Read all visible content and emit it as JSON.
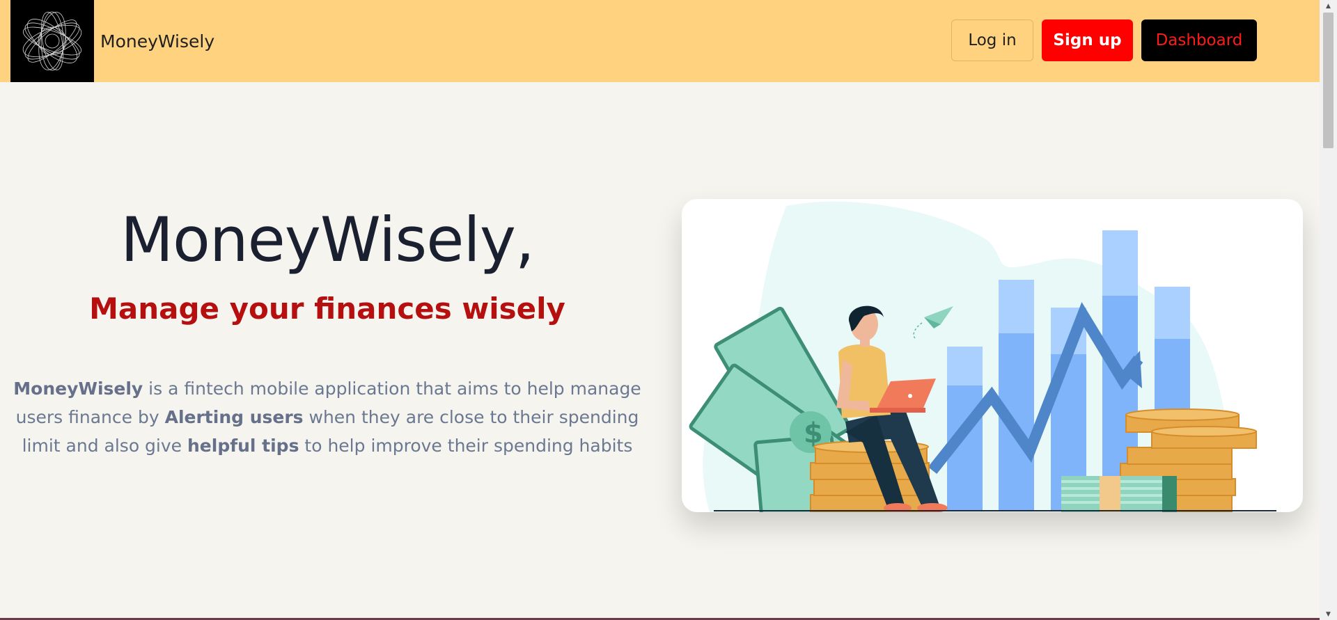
{
  "brand": {
    "name": "MoneyWisely",
    "logo_icon": "spiral-logo-icon"
  },
  "nav": {
    "login_label": "Log in",
    "signup_label": "Sign up",
    "dashboard_label": "Dashboard"
  },
  "hero": {
    "title": "MoneyWisely,",
    "subtitle": "Manage your finances wisely",
    "description": {
      "part1_bold": "MoneyWisely",
      "part2": " is a fintech mobile application that aims to help manage users finance by ",
      "part3_bold": "Alerting users",
      "part4": " when they are close to their spending limit and also give ",
      "part5_bold": "helpful tips",
      "part6": " to help improve their spending habits"
    },
    "illustration_icon": "finance-illustration"
  },
  "colors": {
    "navbar_bg": "#ffd280",
    "page_bg": "#f5f4ee",
    "signup_bg": "#ff0000",
    "dashboard_bg": "#000000",
    "dashboard_text": "#ff1a1a",
    "subtitle": "#b50f0f",
    "title": "#1a2030",
    "description": "#6b7891"
  }
}
